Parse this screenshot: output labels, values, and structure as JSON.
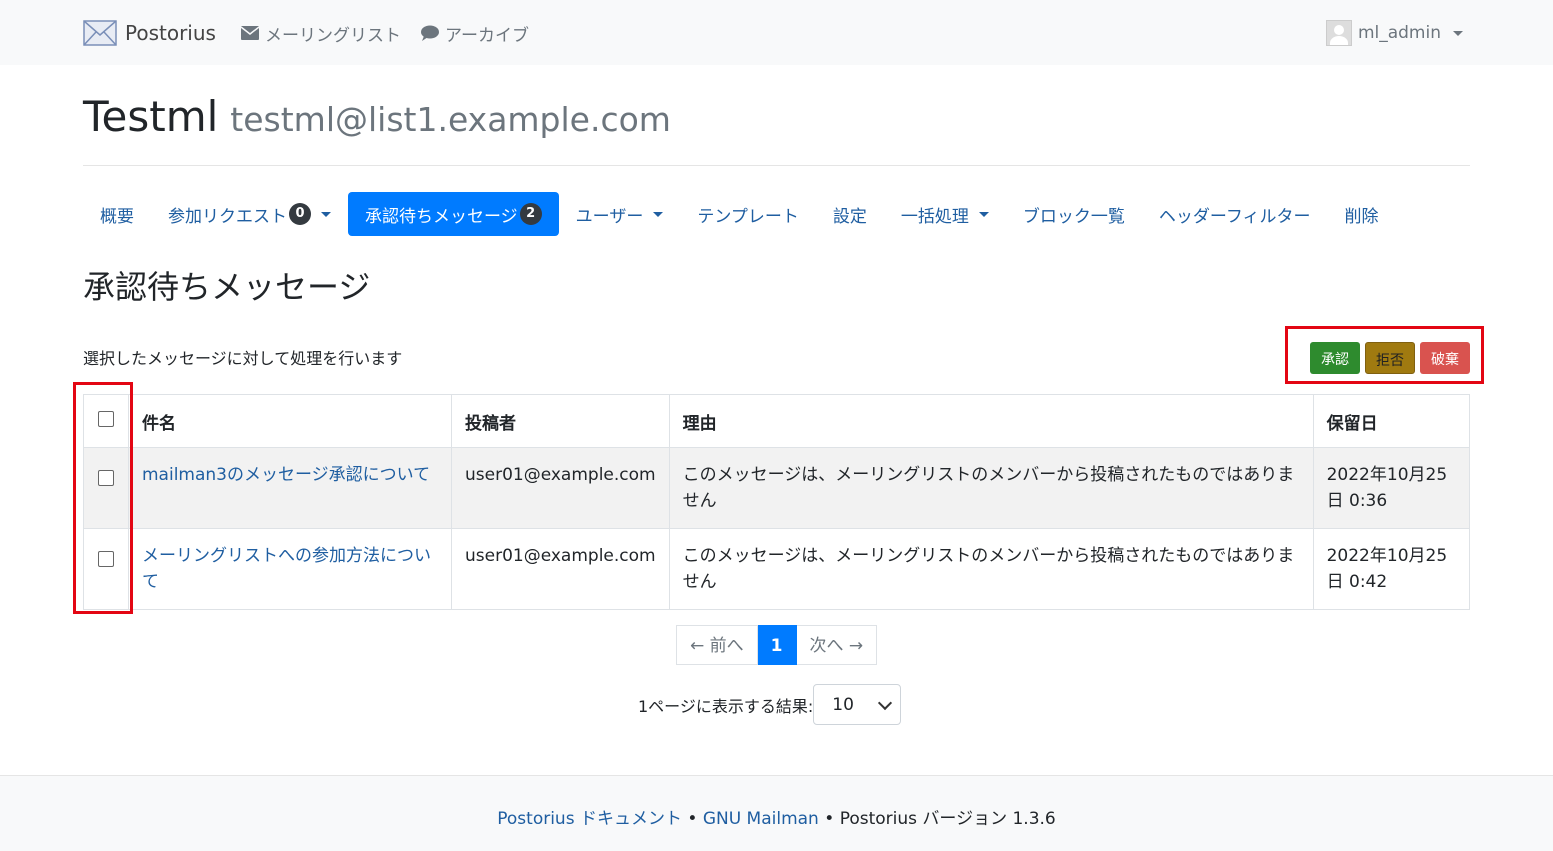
{
  "navbar": {
    "brand": "Postorius",
    "lists_link": "メーリングリスト",
    "archives_link": "アーカイブ",
    "user": "ml_admin"
  },
  "list": {
    "name": "Testml",
    "address": "testml@list1.example.com"
  },
  "tabs": [
    {
      "label": "概要"
    },
    {
      "label": "参加リクエスト",
      "badge": "0"
    },
    {
      "label": "承認待ちメッセージ",
      "badge": "2"
    },
    {
      "label": "ユーザー"
    },
    {
      "label": "テンプレート"
    },
    {
      "label": "設定"
    },
    {
      "label": "一括処理"
    },
    {
      "label": "ブロック一覧"
    },
    {
      "label": "ヘッダーフィルター"
    },
    {
      "label": "削除"
    }
  ],
  "page": {
    "heading": "承認待ちメッセージ",
    "description": "選択したメッセージに対して処理を行います"
  },
  "actions": {
    "approve": "承認",
    "reject": "拒否",
    "discard": "破棄"
  },
  "table": {
    "headers": [
      "件名",
      "投稿者",
      "理由",
      "保留日"
    ],
    "rows": [
      {
        "subject": "mailman3のメッセージ承認について",
        "sender": "user01@example.com",
        "reason": "このメッセージは、メーリングリストのメンバーから投稿されたものではありません",
        "date": "2022年10月25日 0:36"
      },
      {
        "subject": "メーリングリストへの参加方法について",
        "sender": "user01@example.com",
        "reason": "このメッセージは、メーリングリストのメンバーから投稿されたものではありません",
        "date": "2022年10月25日 0:42"
      }
    ]
  },
  "pagination": {
    "prev": "← 前へ",
    "current": "1",
    "next": "次へ →"
  },
  "per_page": {
    "label": "1ページに表示する結果:",
    "value": "10"
  },
  "footer": {
    "docs_link": "Postorius ドキュメント",
    "sep1": " • ",
    "mailman_link": "GNU Mailman",
    "sep2": " • ",
    "version_text": "Postorius バージョン 1.3.6"
  },
  "colors": {
    "primary": "#007bff",
    "link": "#1f5ea1",
    "approve": "#2e8b2e",
    "reject": "#a07a10",
    "discard": "#d9534f",
    "highlight": "#e30613"
  }
}
